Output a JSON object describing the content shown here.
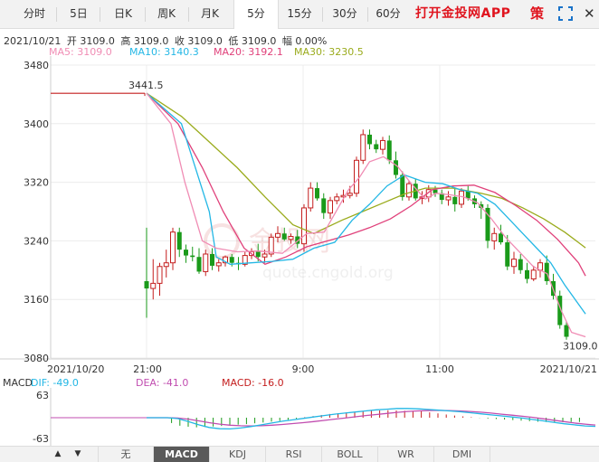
{
  "tabs": [
    {
      "label": "分时",
      "active": false
    },
    {
      "label": "5日",
      "active": false
    },
    {
      "label": "日K",
      "active": false
    },
    {
      "label": "周K",
      "active": false
    },
    {
      "label": "月K",
      "active": false
    },
    {
      "label": "5分",
      "active": true
    },
    {
      "label": "15分",
      "active": false
    },
    {
      "label": "30分",
      "active": false
    },
    {
      "label": "60分",
      "active": false
    }
  ],
  "promo_label": "打开金投网APP",
  "ce_label": "策",
  "icons": {
    "strategy": "strategy-icon",
    "fullscreen": "fullscreen-icon",
    "close": "close-icon"
  },
  "info": {
    "date": "2021/10/21",
    "open": "开 3109.0",
    "high": "高 3109.0",
    "close": "收 3109.0",
    "low": "低 3109.0",
    "change": "幅 0.00%"
  },
  "ma_labels": [
    {
      "text": "MA5: 3109.0",
      "color": "#f08cb4"
    },
    {
      "text": "MA10: 3140.3",
      "color": "#23b7e5"
    },
    {
      "text": "MA20: 3192.1",
      "color": "#e0407a"
    },
    {
      "text": "MA30: 3230.5",
      "color": "#9aab1c"
    }
  ],
  "watermark": {
    "text": "金投网",
    "url": "quote.cngold.org"
  },
  "price_axis": [
    "3480",
    "3400",
    "3320",
    "3240",
    "3160",
    "3080"
  ],
  "time_axis": [
    "2021/10/20",
    "21:00",
    "9:00",
    "11:00",
    "2021/10/21"
  ],
  "annotations": {
    "high": "3441.5",
    "last": "3109.0"
  },
  "macd_labels": {
    "title": "MACD",
    "dif": "DIF: -49.0",
    "dea": "DEA: -41.0",
    "macd": "MACD: -16.0",
    "top": "63",
    "bottom": "-63"
  },
  "indicator_tabs": [
    {
      "label": "无",
      "active": false
    },
    {
      "label": "MACD",
      "active": true
    },
    {
      "label": "KDJ",
      "active": false
    },
    {
      "label": "RSI",
      "active": false
    },
    {
      "label": "BOLL",
      "active": false
    },
    {
      "label": "WR",
      "active": false
    },
    {
      "label": "DMI",
      "active": false
    }
  ],
  "colors": {
    "up": "#c41e1e",
    "down": "#1a9a1a",
    "ma5": "#f08cb4",
    "ma10": "#23b7e5",
    "ma20": "#e0407a",
    "ma30": "#9aab1c"
  },
  "chart_data": {
    "type": "candlestick",
    "ylim": [
      3080,
      3480
    ],
    "candles": [
      [
        3185,
        3258,
        3135,
        3175
      ],
      [
        3175,
        3215,
        3160,
        3182
      ],
      [
        3182,
        3210,
        3165,
        3205
      ],
      [
        3205,
        3228,
        3190,
        3210
      ],
      [
        3210,
        3258,
        3200,
        3252
      ],
      [
        3252,
        3258,
        3218,
        3228
      ],
      [
        3228,
        3235,
        3210,
        3220
      ],
      [
        3220,
        3232,
        3212,
        3218
      ],
      [
        3218,
        3230,
        3195,
        3198
      ],
      [
        3198,
        3228,
        3192,
        3222
      ],
      [
        3222,
        3230,
        3200,
        3206
      ],
      [
        3206,
        3215,
        3198,
        3210
      ],
      [
        3210,
        3220,
        3205,
        3218
      ],
      [
        3218,
        3222,
        3205,
        3210
      ],
      [
        3210,
        3218,
        3200,
        3208
      ],
      [
        3208,
        3225,
        3205,
        3220
      ],
      [
        3220,
        3230,
        3215,
        3225
      ],
      [
        3225,
        3236,
        3212,
        3218
      ],
      [
        3218,
        3228,
        3210,
        3222
      ],
      [
        3222,
        3250,
        3218,
        3245
      ],
      [
        3245,
        3260,
        3238,
        3250
      ],
      [
        3250,
        3258,
        3240,
        3242
      ],
      [
        3242,
        3250,
        3236,
        3246
      ],
      [
        3246,
        3255,
        3230,
        3236
      ],
      [
        3236,
        3290,
        3225,
        3285
      ],
      [
        3285,
        3320,
        3280,
        3312
      ],
      [
        3312,
        3320,
        3295,
        3298
      ],
      [
        3298,
        3305,
        3270,
        3278
      ],
      [
        3278,
        3300,
        3270,
        3295
      ],
      [
        3295,
        3305,
        3290,
        3300
      ],
      [
        3300,
        3310,
        3292,
        3302
      ],
      [
        3302,
        3315,
        3298,
        3305
      ],
      [
        3305,
        3355,
        3300,
        3350
      ],
      [
        3350,
        3392,
        3345,
        3385
      ],
      [
        3385,
        3392,
        3365,
        3372
      ],
      [
        3372,
        3378,
        3360,
        3365
      ],
      [
        3365,
        3382,
        3358,
        3377
      ],
      [
        3377,
        3384,
        3345,
        3350
      ],
      [
        3350,
        3362,
        3325,
        3330
      ],
      [
        3330,
        3335,
        3295,
        3300
      ],
      [
        3300,
        3322,
        3295,
        3318
      ],
      [
        3318,
        3325,
        3295,
        3298
      ],
      [
        3298,
        3308,
        3290,
        3300
      ],
      [
        3300,
        3316,
        3293,
        3310
      ],
      [
        3310,
        3315,
        3300,
        3305
      ],
      [
        3305,
        3310,
        3290,
        3296
      ],
      [
        3296,
        3308,
        3288,
        3300
      ],
      [
        3300,
        3312,
        3280,
        3290
      ],
      [
        3290,
        3312,
        3285,
        3308
      ],
      [
        3308,
        3315,
        3295,
        3298
      ],
      [
        3298,
        3302,
        3285,
        3290
      ],
      [
        3290,
        3294,
        3270,
        3285
      ],
      [
        3285,
        3290,
        3230,
        3240
      ],
      [
        3240,
        3258,
        3228,
        3250
      ],
      [
        3250,
        3262,
        3235,
        3238
      ],
      [
        3238,
        3248,
        3200,
        3205
      ],
      [
        3205,
        3225,
        3195,
        3215
      ],
      [
        3215,
        3222,
        3195,
        3200
      ],
      [
        3200,
        3210,
        3182,
        3188
      ],
      [
        3188,
        3206,
        3185,
        3200
      ],
      [
        3200,
        3215,
        3190,
        3210
      ],
      [
        3210,
        3220,
        3180,
        3185
      ],
      [
        3185,
        3195,
        3160,
        3165
      ],
      [
        3165,
        3172,
        3120,
        3125
      ],
      [
        3125,
        3130,
        3105,
        3109
      ]
    ],
    "ma5": [
      [
        0,
        3441.5
      ],
      [
        7,
        3400
      ],
      [
        11,
        3320
      ],
      [
        16,
        3240
      ],
      [
        20,
        3230
      ],
      [
        26,
        3225
      ],
      [
        32,
        3226
      ],
      [
        39,
        3223
      ],
      [
        46,
        3250
      ],
      [
        51,
        3252
      ],
      [
        58,
        3310
      ],
      [
        61,
        3326
      ],
      [
        64,
        3348
      ],
      [
        68,
        3355
      ],
      [
        72,
        3342
      ],
      [
        76,
        3318
      ],
      [
        80,
        3297
      ],
      [
        83,
        3305
      ],
      [
        87,
        3303
      ],
      [
        91,
        3300
      ],
      [
        95,
        3292
      ],
      [
        99,
        3270
      ],
      [
        103,
        3245
      ],
      [
        108,
        3220
      ],
      [
        111,
        3205
      ],
      [
        115,
        3195
      ],
      [
        119,
        3145
      ],
      [
        122,
        3115
      ],
      [
        126,
        3109
      ]
    ],
    "ma10": [
      [
        0,
        3441.5
      ],
      [
        10,
        3400
      ],
      [
        14,
        3340
      ],
      [
        18,
        3280
      ],
      [
        20,
        3218
      ],
      [
        24,
        3208
      ],
      [
        30,
        3210
      ],
      [
        36,
        3212
      ],
      [
        42,
        3215
      ],
      [
        48,
        3230
      ],
      [
        54,
        3238
      ],
      [
        59,
        3268
      ],
      [
        64,
        3290
      ],
      [
        69,
        3315
      ],
      [
        74,
        3330
      ],
      [
        80,
        3320
      ],
      [
        85,
        3318
      ],
      [
        90,
        3310
      ],
      [
        95,
        3305
      ],
      [
        100,
        3290
      ],
      [
        104,
        3270
      ],
      [
        108,
        3250
      ],
      [
        112,
        3230
      ],
      [
        116,
        3210
      ],
      [
        120,
        3180
      ],
      [
        126,
        3140.3
      ]
    ],
    "ma20": [
      [
        0,
        3441.5
      ],
      [
        9,
        3400
      ],
      [
        16,
        3340
      ],
      [
        22,
        3280
      ],
      [
        28,
        3230
      ],
      [
        34,
        3208
      ],
      [
        40,
        3218
      ],
      [
        46,
        3232
      ],
      [
        52,
        3240
      ],
      [
        58,
        3248
      ],
      [
        64,
        3258
      ],
      [
        70,
        3270
      ],
      [
        76,
        3288
      ],
      [
        82,
        3310
      ],
      [
        88,
        3315
      ],
      [
        94,
        3316
      ],
      [
        100,
        3306
      ],
      [
        106,
        3288
      ],
      [
        112,
        3268
      ],
      [
        118,
        3242
      ],
      [
        124,
        3210
      ],
      [
        126,
        3192.1
      ]
    ],
    "ma30": [
      [
        0,
        3441.5
      ],
      [
        10,
        3410
      ],
      [
        18,
        3375
      ],
      [
        26,
        3340
      ],
      [
        34,
        3300
      ],
      [
        42,
        3262
      ],
      [
        48,
        3250
      ],
      [
        56,
        3268
      ],
      [
        62,
        3280
      ],
      [
        68,
        3292
      ],
      [
        74,
        3304
      ],
      [
        80,
        3312
      ],
      [
        88,
        3312
      ],
      [
        96,
        3305
      ],
      [
        102,
        3298
      ],
      [
        108,
        3285
      ],
      [
        114,
        3270
      ],
      [
        120,
        3252
      ],
      [
        126,
        3230.5
      ]
    ],
    "macd_hist": [
      0,
      0,
      0,
      -20,
      -30,
      -34,
      -36,
      -35,
      -33,
      -31,
      -28,
      -26,
      -24,
      -21,
      -18,
      -15,
      -12,
      -8,
      -4,
      2,
      6,
      10,
      14,
      17,
      20,
      22,
      24,
      26,
      27,
      28,
      27,
      26,
      25,
      24,
      20,
      16,
      12,
      8,
      5,
      2,
      -1,
      -3,
      -5,
      -7,
      -9,
      -11,
      -13,
      -15,
      -16,
      -16,
      -17,
      -16,
      -16
    ],
    "dif": [
      0,
      0,
      0,
      -5,
      -22,
      -40,
      -55,
      -62,
      -63,
      -58,
      -50,
      -40,
      -30,
      -20,
      -12,
      -4,
      4,
      12,
      20,
      26,
      32,
      38,
      44,
      48,
      52,
      52,
      50,
      46,
      42,
      38,
      34,
      28,
      22,
      16,
      10,
      4,
      -2,
      -10,
      -18,
      -26,
      -34,
      -40,
      -46,
      -49
    ],
    "dea": [
      0,
      0,
      0,
      -2,
      -8,
      -18,
      -28,
      -36,
      -42,
      -45,
      -46,
      -45,
      -42,
      -38,
      -33,
      -28,
      -22,
      -15,
      -8,
      -2,
      5,
      12,
      18,
      24,
      30,
      35,
      38,
      40,
      41,
      40,
      38,
      35,
      31,
      26,
      20,
      14,
      8,
      2,
      -6,
      -14,
      -22,
      -30,
      -36,
      -41
    ]
  }
}
